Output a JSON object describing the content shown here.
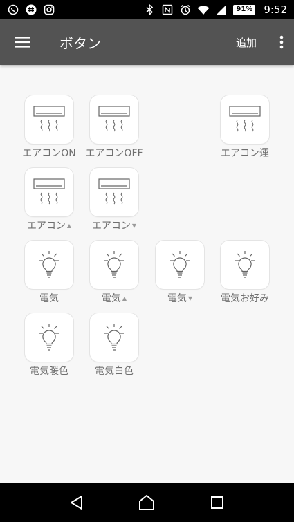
{
  "status_bar": {
    "time": "9:52",
    "battery": "91",
    "icons_left": [
      "whatsapp-icon",
      "hash-app-icon",
      "instagram-icon"
    ],
    "icons_right": [
      "bluetooth-icon",
      "nfc-icon",
      "alarm-icon",
      "wifi-icon",
      "signal-icon",
      "battery-icon"
    ]
  },
  "app_bar": {
    "title": "ボタン",
    "add_label": "追加",
    "color": "#535353"
  },
  "buttons": [
    {
      "label": "エアコンON",
      "icon": "air-conditioner-icon",
      "arrow": ""
    },
    {
      "label": "エアコンOFF",
      "icon": "air-conditioner-icon",
      "arrow": ""
    },
    {
      "label": "エアコン運",
      "icon": "air-conditioner-icon",
      "arrow": ""
    },
    {
      "label": "エアコン",
      "icon": "air-conditioner-icon",
      "arrow": "▲"
    },
    {
      "label": "エアコン",
      "icon": "air-conditioner-icon",
      "arrow": "▼"
    },
    {
      "label": "電気",
      "icon": "light-bulb-icon",
      "arrow": ""
    },
    {
      "label": "電気",
      "icon": "light-bulb-icon",
      "arrow": "▲"
    },
    {
      "label": "電気",
      "icon": "light-bulb-icon",
      "arrow": "▼"
    },
    {
      "label": "電気お好み",
      "icon": "light-bulb-icon",
      "arrow": ""
    },
    {
      "label": "電気暖色",
      "icon": "light-bulb-icon",
      "arrow": ""
    },
    {
      "label": "電気白色",
      "icon": "light-bulb-icon",
      "arrow": ""
    }
  ],
  "nav_bar": {
    "icons": [
      "back-icon",
      "home-icon",
      "recents-icon"
    ]
  }
}
